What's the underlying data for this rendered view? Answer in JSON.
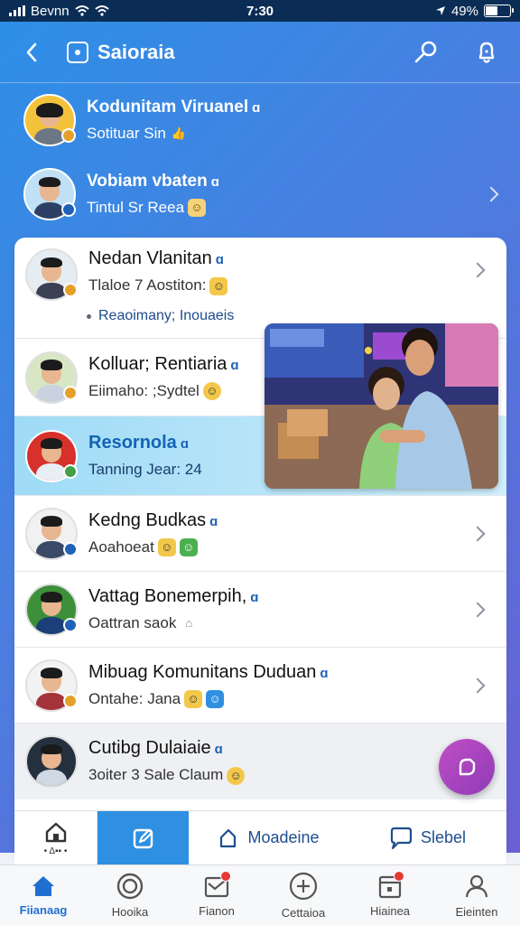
{
  "status_bar": {
    "carrier": "Bevnn",
    "time": "7:30",
    "battery": "49%",
    "battery_level": 0.49
  },
  "header": {
    "title": "Saioraia"
  },
  "rows_top": [
    {
      "name": "Kodunitam Viruanel",
      "subtitle": "Sotituar Sin"
    },
    {
      "name": "Vobiam vbaten",
      "subtitle": "Tintul Sr Reea"
    }
  ],
  "card_rows": [
    {
      "name": "Nedan Vlanitan",
      "subtitle": "Tlaloe 7 Aostiton:",
      "extra": "Reaoimany; Inouaeis"
    },
    {
      "name": "Kolluar; Rentiaria",
      "subtitle": "Eiimaho: ;Sydtel"
    },
    {
      "name": "Resornola",
      "subtitle": "Tanning Jear: 24"
    },
    {
      "name": "Kedng Budkas",
      "subtitle": "Aoahoeat"
    },
    {
      "name": "Vattag Bonemerpih,",
      "subtitle": "Oattran saok"
    },
    {
      "name": "Mibuag Komunitans Duduan",
      "subtitle": "Ontahe: Jana"
    },
    {
      "name": "Cutibg Dulaiaie",
      "subtitle": "3oiter 3 Sale Claum"
    }
  ],
  "toolbar": {
    "home_caption": "• Δ▪▪ •",
    "moderate_label": "Moadeine",
    "select_label": "Slebel"
  },
  "bottom_nav": [
    {
      "label": "Fiianaag"
    },
    {
      "label": "Hooika"
    },
    {
      "label": "Fianon"
    },
    {
      "label": "Cettaioa"
    },
    {
      "label": "Hiainea"
    },
    {
      "label": "Eieinten"
    }
  ],
  "colors": {
    "accent": "#2f8fe0",
    "verified": "#1f61b9",
    "fab": "#b04ac1",
    "highlight": "#9fdbf6"
  }
}
